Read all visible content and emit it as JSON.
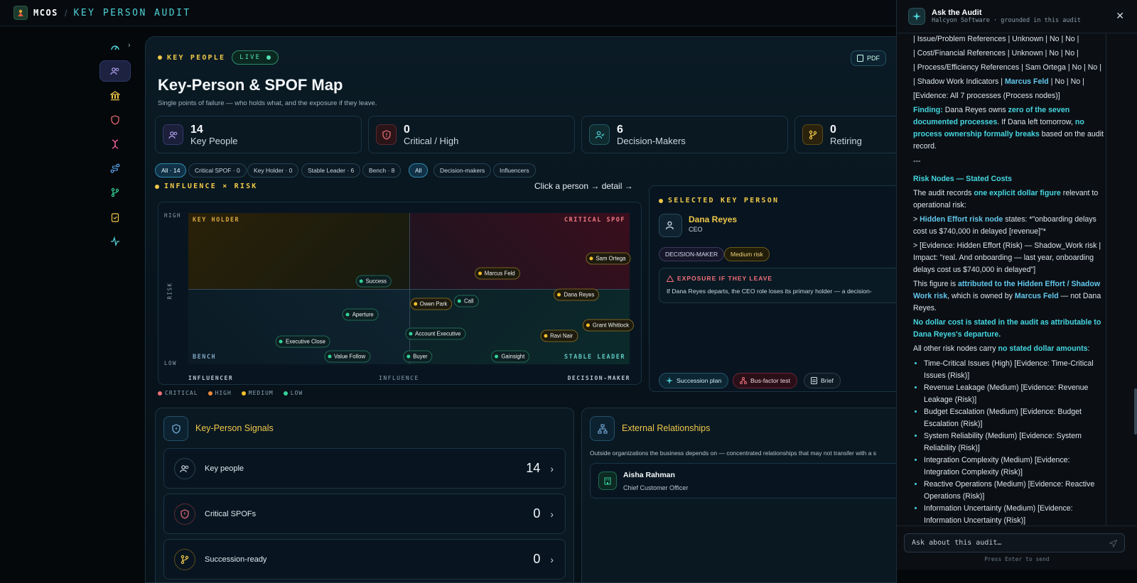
{
  "topbar": {
    "brand": "MCOS",
    "crumb": "KEY PERSON AUDIT"
  },
  "main": {
    "section_label": "KEY PEOPLE",
    "live_label": "LIVE",
    "pdf_label": "PDF",
    "title": "Key-Person & SPOF Map",
    "subtitle": "Single points of failure — who holds what, and the exposure if they leave."
  },
  "stats": [
    {
      "num": "14",
      "label": "Key People",
      "icon": "people-icon",
      "color": "#b9a4f5"
    },
    {
      "num": "0",
      "label": "Critical / High",
      "icon": "shield-alert-icon",
      "color": "#f2707a"
    },
    {
      "num": "6",
      "label": "Decision-Makers",
      "icon": "user-check-icon",
      "color": "#4fd2d6"
    },
    {
      "num": "0",
      "label": "Retiring",
      "icon": "branch-icon",
      "color": "#f0c84a"
    }
  ],
  "filters": {
    "group1": [
      "All · 14",
      "Critical SPOF · 0",
      "Key Holder · 0",
      "Stable Leader · 6",
      "Bench · 8"
    ],
    "group2": [
      "All",
      "Decision-makers",
      "Influencers"
    ]
  },
  "chart_section": {
    "label": "INFLUENCE × RISK",
    "hint": "Click a person → detail →"
  },
  "chart_data": {
    "type": "scatter",
    "xlabel": "INFLUENCE",
    "ylabel": "RISK",
    "x_ticks": [
      "INFLUENCER",
      "DECISION-MAKER"
    ],
    "y_ticks": [
      "HIGH",
      "LOW"
    ],
    "xlim": [
      0,
      1
    ],
    "ylim": [
      0,
      1
    ],
    "quadrants": [
      "KEY HOLDER",
      "CRITICAL SPOF",
      "BENCH",
      "STABLE LEADER"
    ],
    "points": [
      {
        "name": "Sam Ortega",
        "x": 0.96,
        "y": 0.7,
        "level": "medium"
      },
      {
        "name": "Marcus Feld",
        "x": 0.7,
        "y": 0.6,
        "level": "medium"
      },
      {
        "name": "Success",
        "x": 0.42,
        "y": 0.55,
        "level": "low"
      },
      {
        "name": "Dana Reyes",
        "x": 0.88,
        "y": 0.46,
        "level": "medium"
      },
      {
        "name": "Owen Park",
        "x": 0.55,
        "y": 0.4,
        "level": "medium"
      },
      {
        "name": "Call",
        "x": 0.63,
        "y": 0.42,
        "level": "low"
      },
      {
        "name": "Aperture",
        "x": 0.39,
        "y": 0.33,
        "level": "low"
      },
      {
        "name": "Account Executive",
        "x": 0.56,
        "y": 0.2,
        "level": "low"
      },
      {
        "name": "Ravi Nair",
        "x": 0.84,
        "y": 0.19,
        "level": "medium"
      },
      {
        "name": "Grant Whitlock",
        "x": 1.0,
        "y": 0.26,
        "level": "medium"
      },
      {
        "name": "Executive Close",
        "x": 0.26,
        "y": 0.15,
        "level": "low"
      },
      {
        "name": "Value Follow",
        "x": 0.36,
        "y": 0.05,
        "level": "low"
      },
      {
        "name": "Buyer",
        "x": 0.52,
        "y": 0.05,
        "level": "low"
      },
      {
        "name": "Gainsight",
        "x": 0.73,
        "y": 0.05,
        "level": "low"
      }
    ],
    "legend": [
      "CRITICAL",
      "HIGH",
      "MEDIUM",
      "LOW"
    ]
  },
  "selected": {
    "label": "SELECTED KEY PERSON",
    "name": "Dana Reyes",
    "role": "CEO",
    "badges": [
      "DECISION-MAKER",
      "Medium risk"
    ],
    "exposure_title": "EXPOSURE IF THEY LEAVE",
    "exposure_text": "If Dana Reyes departs, the CEO role loses its primary holder — a decision-",
    "actions": [
      "Succession plan",
      "Bus-factor test",
      "Brief"
    ]
  },
  "signals": {
    "title": "Key-Person Signals",
    "rows": [
      {
        "label": "Key people",
        "value": "14"
      },
      {
        "label": "Critical SPOFs",
        "value": "0"
      },
      {
        "label": "Succession-ready",
        "value": "0"
      }
    ]
  },
  "external": {
    "title": "External Relationships",
    "desc": "Outside organizations the business depends on — concentrated relationships that may not transfer with a s",
    "contact_name": "Aisha Rahman",
    "contact_role": "Chief Customer Officer"
  },
  "ai": {
    "title": "Ask the Audit",
    "subtitle": "Halcyon Software · grounded in this audit",
    "lines": [
      "| Issue/Problem References | Unknown | No | No |",
      "| Cost/Financial References | Unknown | No | No |",
      "| Process/Efficiency References | Sam Ortega | No | No |",
      "| Shadow Work Indicators | ",
      "Marcus Feld",
      " | No | No |",
      "[Evidence: All 7 processes (Process nodes)]",
      "Finding:",
      " Dana Reyes owns ",
      "zero of the seven documented processes",
      ". If Dana left tomorrow, ",
      "no process ownership formally breaks",
      " based on the audit record.",
      "---",
      "Risk Nodes — Stated Costs",
      "The audit records ",
      "one explicit dollar figure",
      " relevant to operational risk:",
      "> ",
      "Hidden Effort risk node",
      " states: *\"onboarding delays cost us $740,000 in delayed [revenue]\"*",
      "> [Evidence: Hidden Effort (Risk) — Shadow_Work risk | Impact: \"real. And onboarding — last year, onboarding delays cost us $740,000 in delayed\"]",
      "This figure is ",
      "attributed to the Hidden Effort / Shadow Work risk",
      ", which is owned by ",
      "Marcus Feld",
      " — not Dana Reyes.",
      "No dollar cost is stated in the audit as attributable to Dana Reyes's departure.",
      "All other risk nodes carry ",
      "no stated dollar amounts",
      ":",
      "Time-Critical Issues (High) [Evidence: Time-Critical Issues (Risk)]",
      "Revenue Leakage (Medium) [Evidence: Revenue Leakage (Risk)]",
      "Budget Escalation (Medium) [Evidence: Budget Escalation (Risk)]",
      "System Reliability (Medium) [Evidence: System Reliability (Risk)]",
      "Integration Complexity (Medium) [Evidence: Integration Complexity (Risk)]",
      "Reactive Operations (Medium) [Evidence: Reactive Operations (Risk)]",
      "Information Uncertainty (Medium) [Evidence: Information Uncertainty (Risk)]"
    ],
    "input_placeholder": "Ask about this audit…",
    "hint": "Press Enter to send"
  }
}
